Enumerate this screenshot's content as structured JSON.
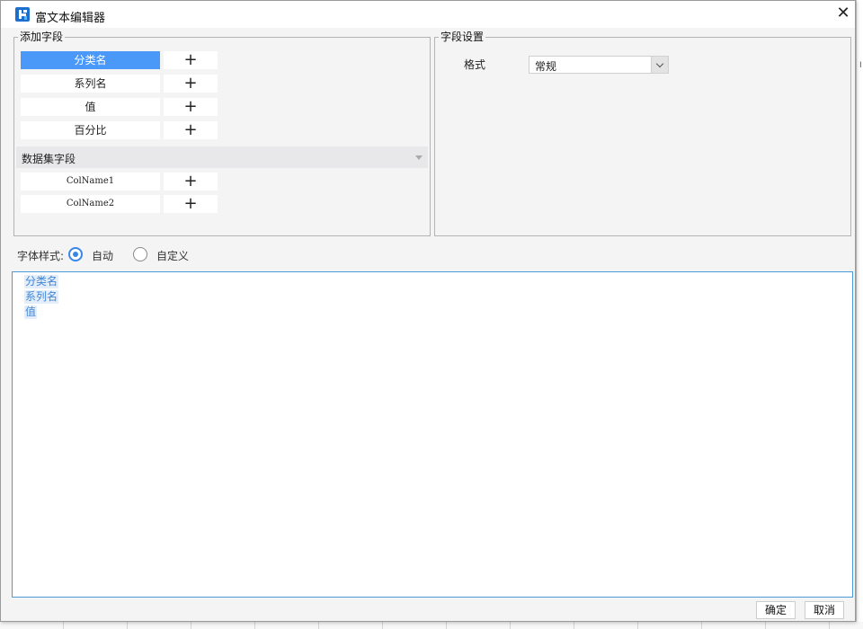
{
  "window": {
    "title": "富文本编辑器",
    "close_glyph": "✕"
  },
  "add_fields": {
    "legend": "添加字段",
    "add_glyph": "+",
    "fields": [
      {
        "label": "分类名",
        "selected": true
      },
      {
        "label": "系列名",
        "selected": false
      },
      {
        "label": "值",
        "selected": false
      },
      {
        "label": "百分比",
        "selected": false
      }
    ],
    "dataset": {
      "label": "数据集字段",
      "fields": [
        {
          "label": "ColName1"
        },
        {
          "label": "ColName2"
        }
      ]
    }
  },
  "field_settings": {
    "legend": "字段设置",
    "format_label": "格式",
    "format_value": "常规"
  },
  "font_style": {
    "label": "字体样式:",
    "options": [
      {
        "label": "自动",
        "checked": true
      },
      {
        "label": "自定义",
        "checked": false
      }
    ]
  },
  "editor": {
    "tokens": [
      "分类名",
      "系列名",
      "值"
    ]
  },
  "footer": {
    "ok_label": "确定",
    "cancel_label": "取消"
  },
  "colors": {
    "accent": "#4a98f7",
    "editor_border": "#4a9bd8",
    "token_text": "#3f86d6"
  }
}
